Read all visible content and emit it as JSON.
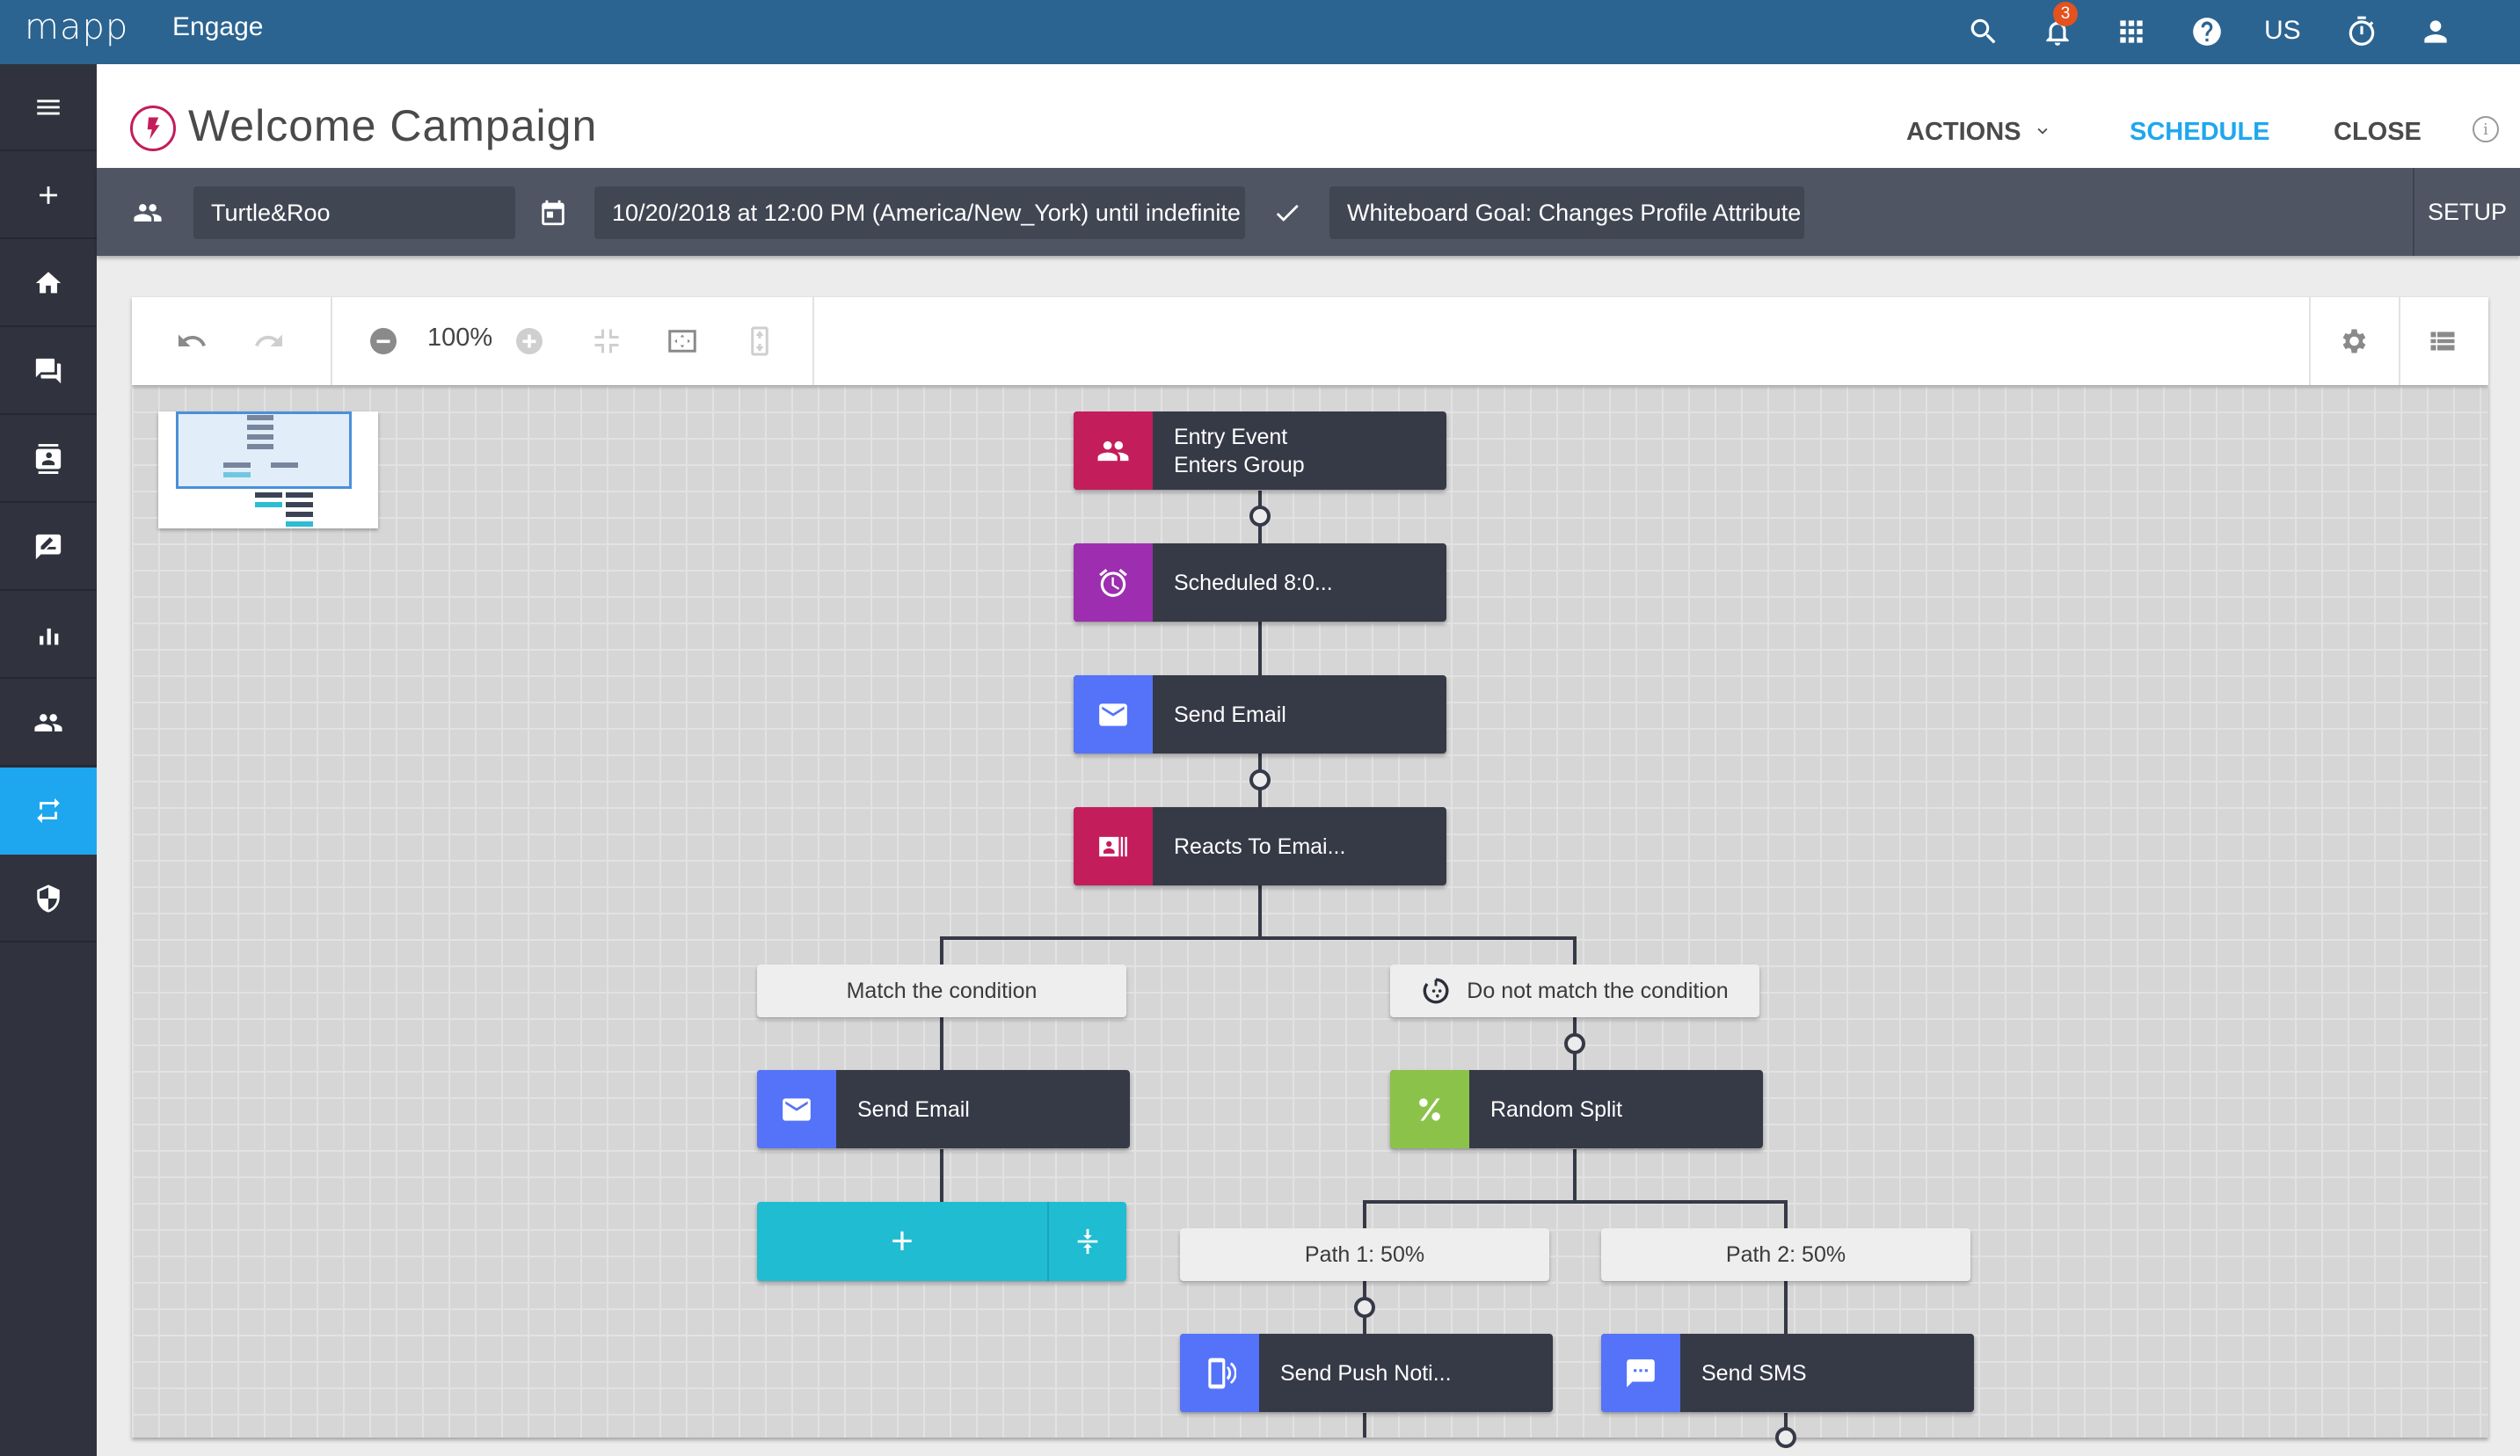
{
  "topbar": {
    "logo": "mapp",
    "product": "Engage",
    "notification_count": "3",
    "locale": "US",
    "icons": [
      "search-icon",
      "bell-icon",
      "apps-grid-icon",
      "help-icon",
      "timer-icon",
      "user-icon"
    ]
  },
  "sidebar": {
    "items": [
      {
        "name": "menu",
        "icon": "hamburger-icon"
      },
      {
        "name": "create",
        "icon": "plus-icon"
      },
      {
        "name": "home",
        "icon": "home-icon"
      },
      {
        "name": "messages",
        "icon": "chat-icon"
      },
      {
        "name": "contacts",
        "icon": "contact-card-icon"
      },
      {
        "name": "feedback",
        "icon": "edit-comment-icon"
      },
      {
        "name": "analytics",
        "icon": "bar-chart-icon"
      },
      {
        "name": "audience",
        "icon": "people-icon"
      },
      {
        "name": "automation",
        "icon": "repeat-icon",
        "active": true
      },
      {
        "name": "security",
        "icon": "shield-icon"
      }
    ]
  },
  "header": {
    "title": "Welcome Campaign",
    "actions_label": "ACTIONS",
    "schedule_label": "SCHEDULE",
    "close_label": "CLOSE",
    "info_glyph": "i",
    "colors": {
      "schedule": "#1ea7ee",
      "title_icon": "#c51c5b"
    }
  },
  "infobar": {
    "group": "Turtle&Roo",
    "schedule": "10/20/2018 at 12:00 PM (America/New_York) until indefinite",
    "goal": "Whiteboard Goal: Changes Profile Attribute",
    "setup_label": "SETUP"
  },
  "toolbar": {
    "zoom_level": "100%"
  },
  "flow": {
    "nodes": [
      {
        "id": "entry",
        "line1": "Entry Event",
        "line2": "Enters Group",
        "color": "#c41d5c",
        "icon": "group-icon"
      },
      {
        "id": "scheduled",
        "line1": "Scheduled 8:0...",
        "color": "#9c2eaf",
        "icon": "alarm-icon"
      },
      {
        "id": "send-email-1",
        "line1": "Send Email",
        "color": "#5473f9",
        "icon": "email-icon"
      },
      {
        "id": "reacts",
        "line1": "Reacts To Emai...",
        "color": "#c41d5c",
        "icon": "contact-reaction-icon"
      },
      {
        "id": "send-email-2",
        "line1": "Send Email",
        "color": "#5473f9",
        "icon": "email-icon"
      },
      {
        "id": "random-split",
        "line1": "Random Split",
        "color": "#8bc34a",
        "icon": "percent-icon"
      },
      {
        "id": "push",
        "line1": "Send Push Noti...",
        "color": "#5473f9",
        "icon": "phone-vibrate-icon"
      },
      {
        "id": "sms",
        "line1": "Send SMS",
        "color": "#5473f9",
        "icon": "sms-icon"
      }
    ],
    "branches": {
      "match": "Match the condition",
      "no_match": "Do not match the condition",
      "path1": "Path 1: 50%",
      "path2": "Path 2: 50%"
    },
    "add_block_color": "#1fbcd2",
    "add_glyph": "+"
  }
}
